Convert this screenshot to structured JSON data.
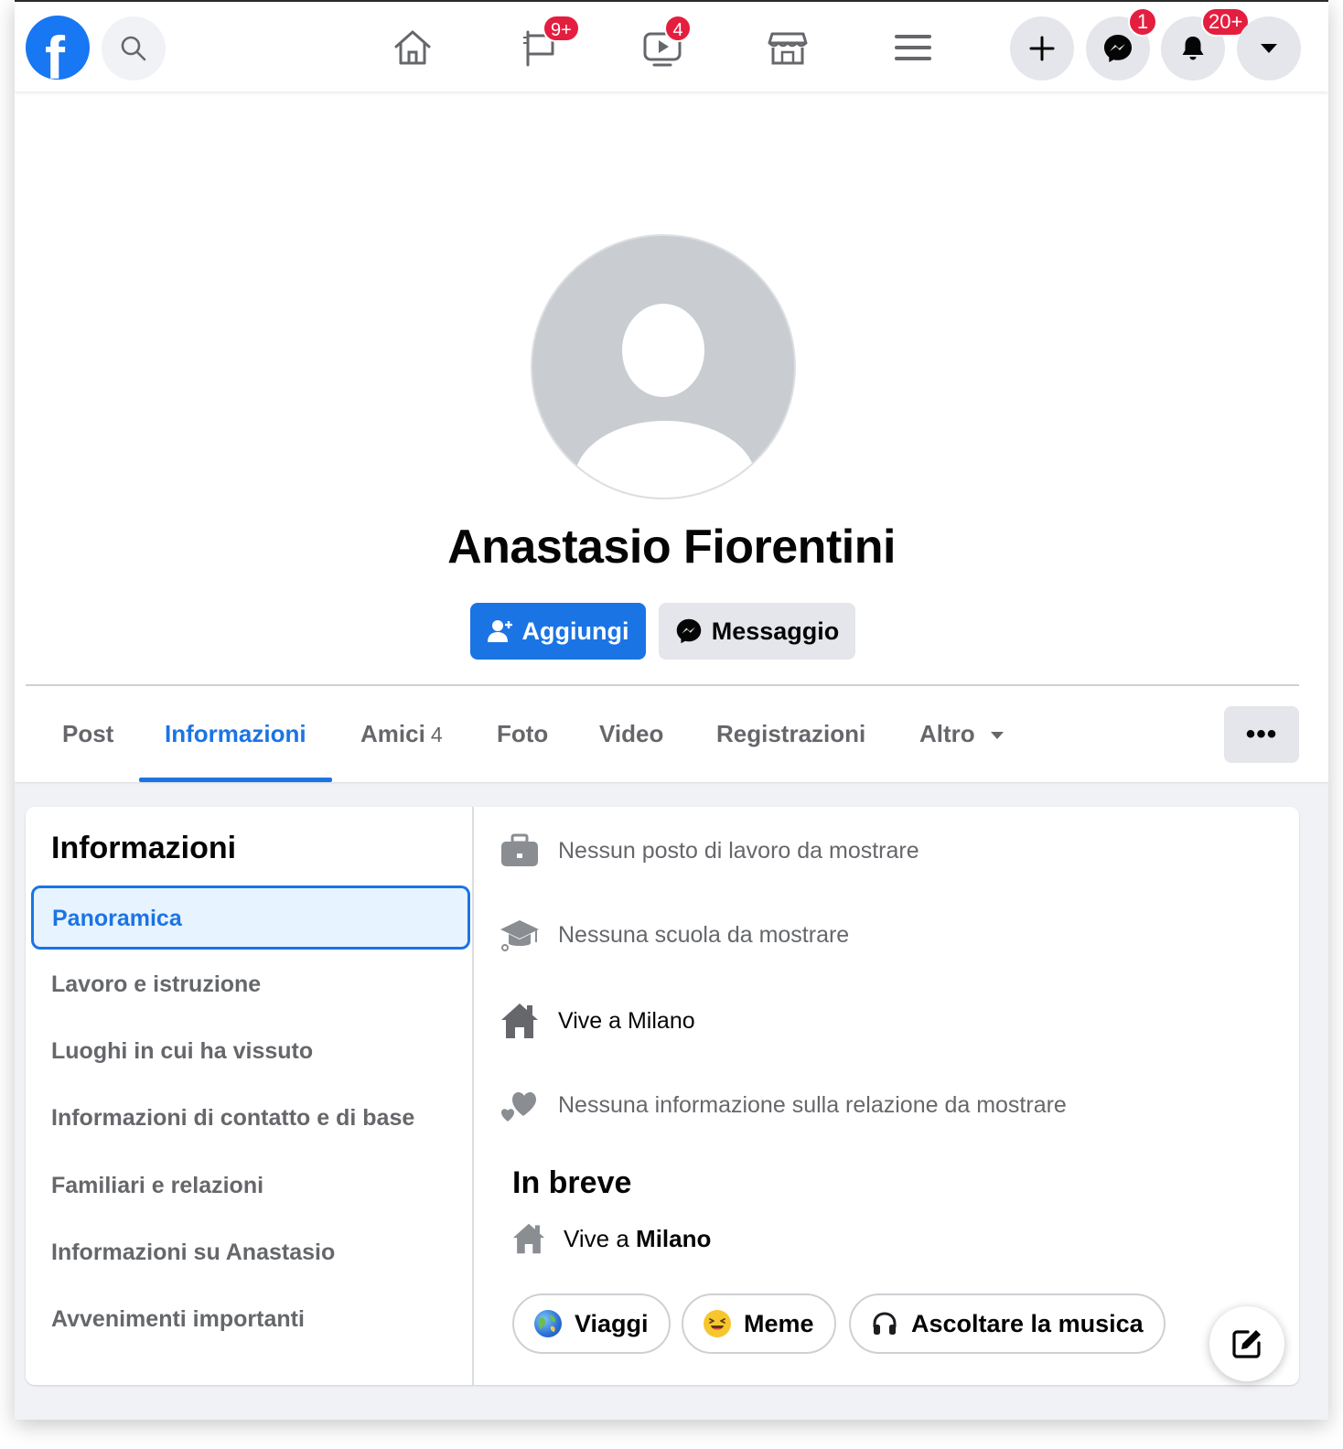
{
  "topbar": {
    "logo_letter": "f",
    "badges": {
      "pages": "9+",
      "watch": "4",
      "messenger": "1",
      "notifications": "20+"
    },
    "icons": [
      "search-icon",
      "home-icon",
      "flag-icon",
      "watch-icon",
      "marketplace-icon",
      "menu-icon",
      "plus-icon",
      "messenger-icon",
      "bell-icon",
      "chevron-down-icon"
    ]
  },
  "profile": {
    "name": "Anastasio Fiorentini",
    "add_label": "Aggiungi",
    "message_label": "Messaggio"
  },
  "tabs": [
    {
      "label": "Post"
    },
    {
      "label": "Informazioni",
      "active": true
    },
    {
      "label": "Amici",
      "count": "4"
    },
    {
      "label": "Foto"
    },
    {
      "label": "Video"
    },
    {
      "label": "Registrazioni"
    },
    {
      "label": "Altro"
    }
  ],
  "more_label": "•••",
  "about": {
    "title": "Informazioni",
    "nav": [
      "Panoramica",
      "Lavoro e istruzione",
      "Luoghi in cui ha vissuto",
      "Informazioni di contatto e di base",
      "Familiari e relazioni",
      "Informazioni su Anastasio",
      "Avvenimenti importanti"
    ],
    "rows": {
      "work": "Nessun posto di lavoro da mostrare",
      "school": "Nessuna scuola da mostrare",
      "lives": "Vive a Milano",
      "relationship": "Nessuna informazione sulla relazione da mostrare"
    },
    "brief": {
      "title": "In breve",
      "lives_prefix": "Vive a",
      "lives_city": "Milano"
    },
    "chips": [
      "Viaggi",
      "Meme",
      "Ascoltare la musica"
    ]
  },
  "colors": {
    "accent": "#1b74e4",
    "badge": "#e41e3f",
    "secondary_text": "#65676b"
  }
}
